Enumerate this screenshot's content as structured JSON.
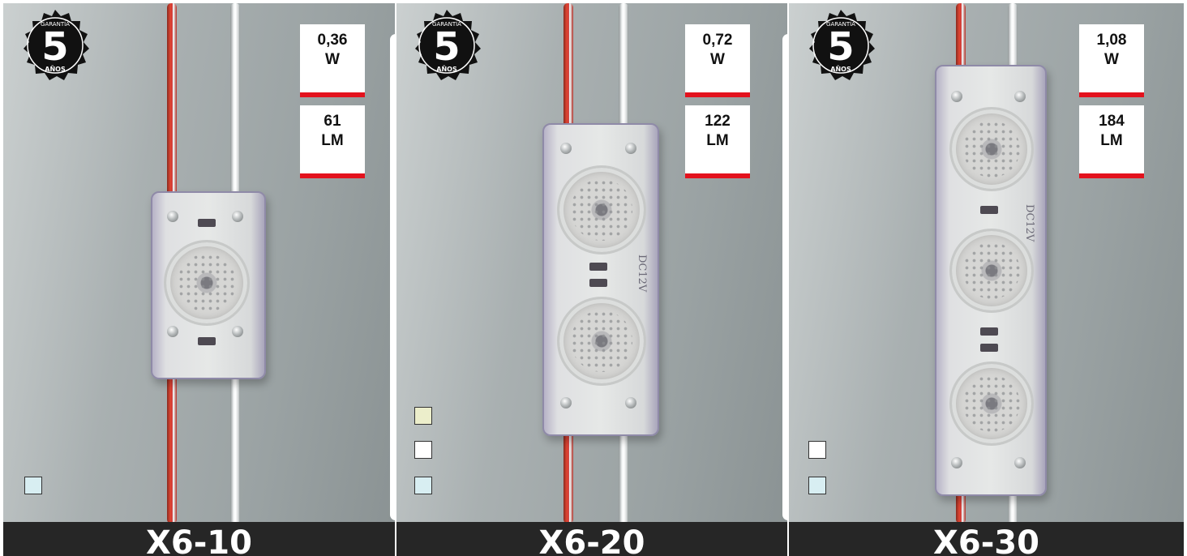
{
  "panels": [
    {
      "badge": {
        "top_text": "GARANTÍA",
        "number": "5",
        "bottom_text": "AÑOS"
      },
      "power": {
        "value": "0,36",
        "unit": "W"
      },
      "lumens": {
        "value": "61",
        "unit": "LM"
      },
      "printed_label": "",
      "swatch_colors": [
        "#d8eef2"
      ],
      "model": "X6-10"
    },
    {
      "badge": {
        "top_text": "GARANTÍA",
        "number": "5",
        "bottom_text": "AÑOS"
      },
      "power": {
        "value": "0,72",
        "unit": "W"
      },
      "lumens": {
        "value": "122",
        "unit": "LM"
      },
      "printed_label": "DC12V",
      "swatch_colors": [
        "#eceecb",
        "#ffffff",
        "#d8eef2"
      ],
      "model": "X6-20"
    },
    {
      "badge": {
        "top_text": "GARANTÍA",
        "number": "5",
        "bottom_text": "AÑOS"
      },
      "power": {
        "value": "1,08",
        "unit": "W"
      },
      "lumens": {
        "value": "184",
        "unit": "LM"
      },
      "printed_label": "DC12V",
      "swatch_colors": [
        "#ffffff",
        "#d8eef2"
      ],
      "model": "X6-30"
    }
  ],
  "colors": {
    "accent": "#e3121d",
    "bar": "#262626",
    "badge": "#111111"
  }
}
